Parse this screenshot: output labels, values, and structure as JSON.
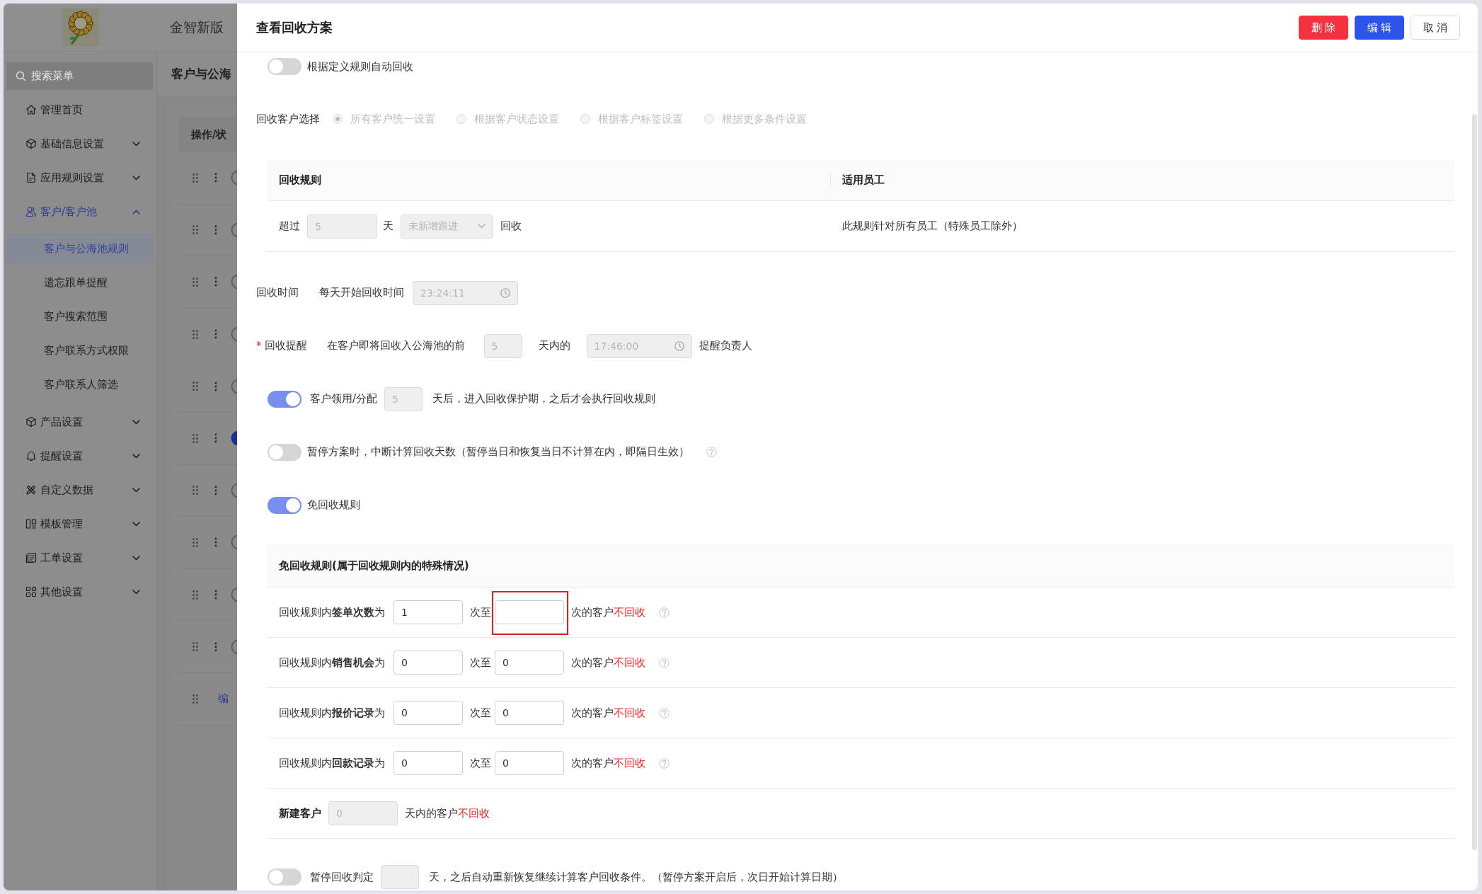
{
  "app": {
    "title": "金智新版"
  },
  "sidebar": {
    "search": {
      "placeholder": "搜索菜单"
    },
    "items": [
      {
        "kind": "link",
        "label": "管理首页"
      },
      {
        "kind": "group",
        "label": "基础信息设置",
        "expanded": false
      },
      {
        "kind": "group",
        "label": "应用规则设置",
        "expanded": false
      },
      {
        "kind": "group",
        "label": "客户/客户池",
        "expanded": true,
        "children": [
          {
            "label": "客户与公海池规则",
            "selected": true
          },
          {
            "label": "遗忘跟单提醒",
            "selected": false
          },
          {
            "label": "客户搜索范围",
            "selected": false
          },
          {
            "label": "客户联系方式权限",
            "selected": false
          },
          {
            "label": "客户联系人筛选",
            "selected": false
          }
        ]
      },
      {
        "kind": "group",
        "label": "产品设置",
        "expanded": false
      },
      {
        "kind": "group",
        "label": "提醒设置",
        "expanded": false
      },
      {
        "kind": "group",
        "label": "自定义数据",
        "expanded": false
      },
      {
        "kind": "group",
        "label": "模板管理",
        "expanded": false
      },
      {
        "kind": "group",
        "label": "工单设置",
        "expanded": false
      },
      {
        "kind": "group",
        "label": "其他设置",
        "expanded": false
      }
    ]
  },
  "background": {
    "title": "客户与公海",
    "table": {
      "column": "操作/状",
      "rows": [
        {
          "kind": "toggle",
          "on": false
        },
        {
          "kind": "toggle",
          "on": false
        },
        {
          "kind": "toggle",
          "on": false
        },
        {
          "kind": "toggle",
          "on": false
        },
        {
          "kind": "toggle",
          "on": false
        },
        {
          "kind": "toggle",
          "on": true
        },
        {
          "kind": "toggle",
          "on": false
        },
        {
          "kind": "toggle",
          "on": false
        },
        {
          "kind": "toggle",
          "on": false
        },
        {
          "kind": "toggle",
          "on": false
        },
        {
          "kind": "link",
          "link": "编"
        }
      ]
    }
  },
  "drawer": {
    "title": "查看回收方案",
    "buttons": [
      {
        "label": "删除",
        "kind": "danger"
      },
      {
        "label": "编辑",
        "kind": "primary"
      },
      {
        "label": "取消",
        "kind": "default"
      }
    ],
    "auto_recycle": {
      "on": false,
      "label": "根据定义规则自动回收"
    },
    "customer_selection": {
      "label": "回收客户选择",
      "disabled": true,
      "options": [
        {
          "label": "所有客户统一设置",
          "selected": true
        },
        {
          "label": "根据客户状态设置",
          "selected": false
        },
        {
          "label": "根据客户标签设置",
          "selected": false
        },
        {
          "label": "根据更多条件设置",
          "selected": false
        }
      ]
    },
    "rules_table": {
      "columns": [
        "回收规则",
        "适用员工"
      ],
      "rows": [
        {
          "before": "超过",
          "days": {
            "value": "5",
            "disabled": true
          },
          "unit": "天",
          "condition": {
            "value": "未新增跟进",
            "disabled": true
          },
          "after": "回收",
          "staff": "此规则针对所有员工（特殊员工除外）"
        }
      ]
    },
    "recycle_time": {
      "label": "回收时间",
      "caption": "每天开始回收时间",
      "time": {
        "value": "23:24:11",
        "disabled": true
      }
    },
    "reminder": {
      "required_mark": "*",
      "label": "回收提醒",
      "before": "在客户即将回收入公海池的前",
      "days": {
        "value": "5",
        "disabled": true
      },
      "middle": "天内的",
      "time": {
        "value": "17:46:00",
        "disabled": true
      },
      "after": "提醒负责人"
    },
    "switches": [
      {
        "kind": "with_input",
        "on": true,
        "label": "客户领用/分配",
        "field": {
          "value": "5",
          "disabled": true
        },
        "after": "天后，进入回收保护期，之后才会执行回收规则"
      },
      {
        "kind": "with_help",
        "on": false,
        "label": "暂停方案时，中断计算回收天数（暂停当日和恢复当日不计算在内，即隔日生效）"
      },
      {
        "kind": "plain",
        "on": true,
        "label": "免回收规则"
      }
    ],
    "exemption_table": {
      "title": "免回收规则(属于回收规则内的特殊情况)",
      "rows": [
        {
          "kind": "range",
          "label": "回收规则内**签单次数**为",
          "from": {
            "value": "1",
            "disabled": false
          },
          "between": "次至",
          "to": {
            "disabled": false,
            "highlighted": true
          },
          "after": "次的客户",
          "warning": "不回收"
        },
        {
          "kind": "range",
          "label": "回收规则内**销售机会**为",
          "from": {
            "value": "0",
            "disabled": false
          },
          "between": "次至",
          "to": {
            "value": "0",
            "disabled": false,
            "highlighted": false
          },
          "after": "次的客户",
          "warning": "不回收"
        },
        {
          "kind": "range",
          "label": "回收规则内**报价记录**为",
          "from": {
            "value": "0",
            "disabled": false
          },
          "between": "次至",
          "to": {
            "value": "0",
            "disabled": false,
            "highlighted": false
          },
          "after": "次的客户",
          "warning": "不回收"
        },
        {
          "kind": "range",
          "label": "回收规则内**回款记录**为",
          "from": {
            "value": "0",
            "disabled": false
          },
          "between": "次至",
          "to": {
            "value": "0",
            "disabled": false,
            "highlighted": false
          },
          "after": "次的客户",
          "warning": "不回收"
        },
        {
          "kind": "days",
          "label": "新建客户",
          "field": {
            "value": "0",
            "disabled": true
          },
          "after": "天内的客户",
          "warning": "不回收"
        }
      ]
    },
    "pause": {
      "on": false,
      "label": "暂停回收判定",
      "field": {
        "disabled": true
      },
      "after": "天，之后自动重新恢复继续计算客户回收条件。（暂停方案开启后，次日开始计算日期）"
    }
  }
}
